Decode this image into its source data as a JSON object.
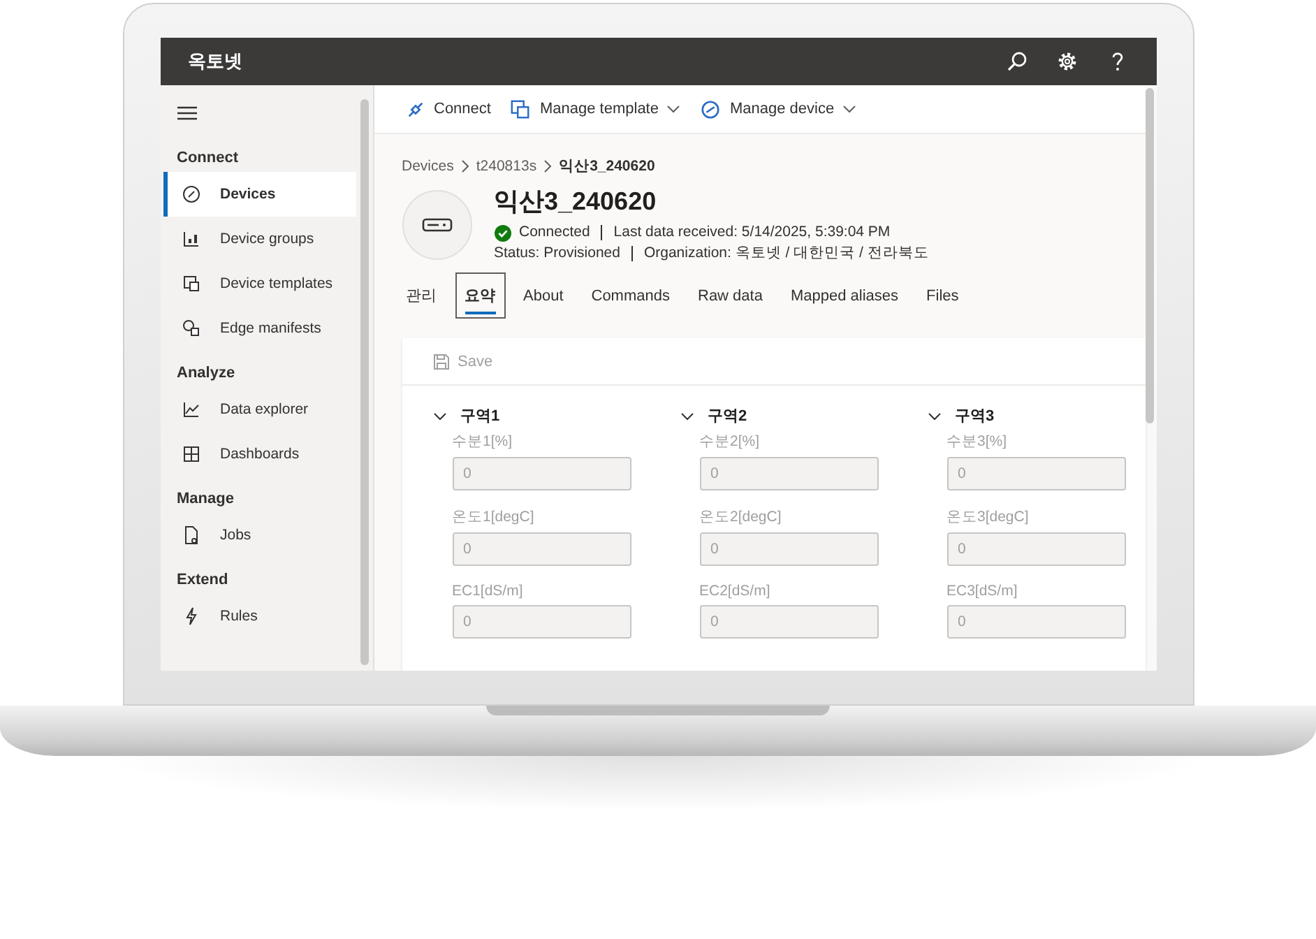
{
  "app": {
    "title": "옥토넷"
  },
  "toolbar": [
    {
      "label": "Connect",
      "kind": "plain"
    },
    {
      "label": "Manage template",
      "kind": "dropdown"
    },
    {
      "label": "Manage device",
      "kind": "dropdown"
    }
  ],
  "sidebar": {
    "sections": [
      {
        "heading": "Connect",
        "items": [
          {
            "label": "Devices",
            "selected": true
          },
          {
            "label": "Device groups",
            "selected": false
          },
          {
            "label": "Device templates",
            "selected": false
          },
          {
            "label": "Edge manifests",
            "selected": false
          }
        ]
      },
      {
        "heading": "Analyze",
        "items": [
          {
            "label": "Data explorer",
            "selected": false
          },
          {
            "label": "Dashboards",
            "selected": false
          }
        ]
      },
      {
        "heading": "Manage",
        "items": [
          {
            "label": "Jobs",
            "selected": false
          }
        ]
      },
      {
        "heading": "Extend",
        "items": [
          {
            "label": "Rules",
            "selected": false
          }
        ]
      }
    ]
  },
  "breadcrumb": [
    "Devices",
    "t240813s",
    "익산3_240620"
  ],
  "device": {
    "name": "익산3_240620",
    "connection": "Connected",
    "connected": true,
    "last_data": "Last data received: 5/14/2025, 5:39:04 PM",
    "status": "Status: Provisioned",
    "organization": "Organization: 옥토넷 / 대한민국 / 전라북도"
  },
  "tabs": [
    {
      "label": "관리",
      "selected": false
    },
    {
      "label": "요약",
      "selected": true
    },
    {
      "label": "About",
      "selected": false
    },
    {
      "label": "Commands",
      "selected": false
    },
    {
      "label": "Raw data",
      "selected": false
    },
    {
      "label": "Mapped aliases",
      "selected": false
    },
    {
      "label": "Files",
      "selected": false
    }
  ],
  "form": {
    "save": {
      "label": "Save",
      "disabled": true
    },
    "groups": [
      {
        "title": "구역1",
        "expanded": true,
        "fields": [
          {
            "label": "수분1[%]",
            "value": "0",
            "disabled": true
          },
          {
            "label": "온도1[degC]",
            "value": "0",
            "disabled": true
          },
          {
            "label": "EC1[dS/m]",
            "value": "0",
            "disabled": true
          }
        ]
      },
      {
        "title": "구역2",
        "expanded": true,
        "fields": [
          {
            "label": "수분2[%]",
            "value": "0",
            "disabled": true
          },
          {
            "label": "온도2[degC]",
            "value": "0",
            "disabled": true
          },
          {
            "label": "EC2[dS/m]",
            "value": "0",
            "disabled": true
          }
        ]
      },
      {
        "title": "구역3",
        "expanded": true,
        "fields": [
          {
            "label": "수분3[%]",
            "value": "0",
            "disabled": true
          },
          {
            "label": "온도3[degC]",
            "value": "0",
            "disabled": true
          },
          {
            "label": "EC3[dS/m]",
            "value": "0",
            "disabled": true
          }
        ]
      }
    ]
  }
}
